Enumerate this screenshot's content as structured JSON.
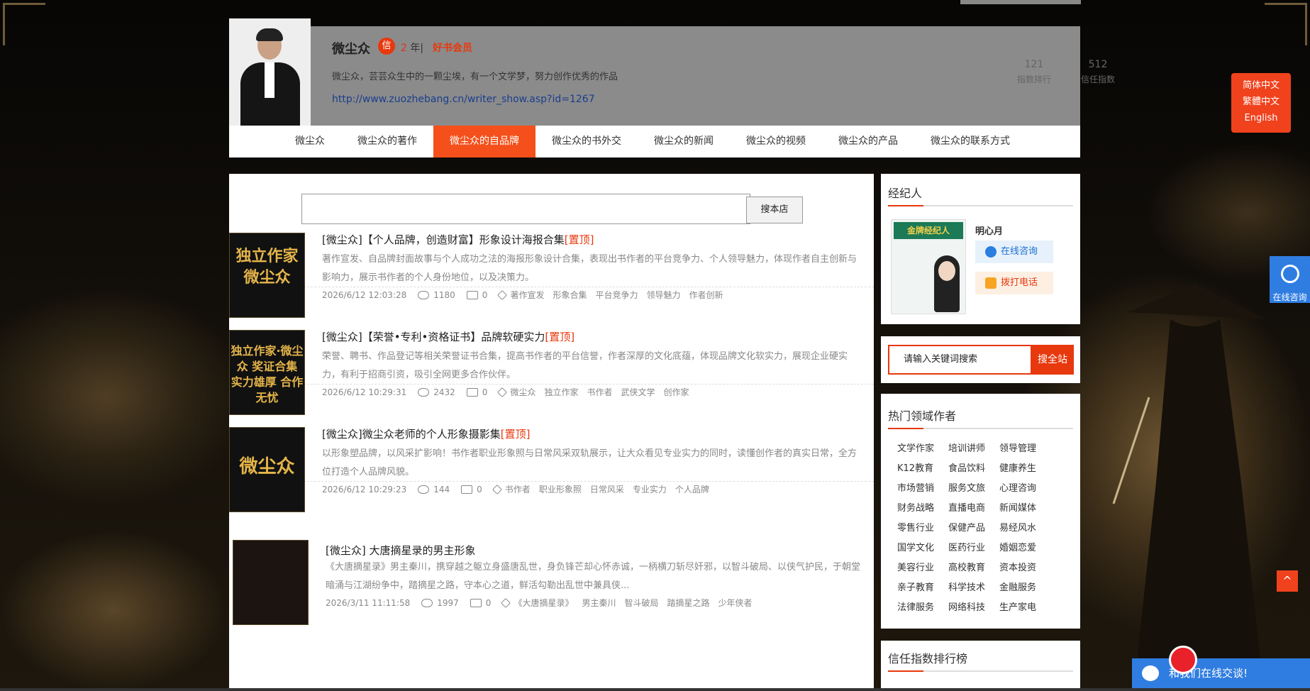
{
  "profile": {
    "name": "微尘众",
    "badge": "信",
    "years": "2",
    "years_unit": "年",
    "sep": "|",
    "member": "好书会员",
    "desc": "微尘众，芸芸众生中的一颗尘埃，有一个文学梦，努力创作优秀的作品",
    "url": "http://www.zuozhebang.cn/writer_show.asp?id=1267",
    "stats": [
      {
        "value": "121",
        "label": "指数排行"
      },
      {
        "value": "512",
        "label": "信任指数"
      }
    ]
  },
  "nav": {
    "items": [
      {
        "label": "微尘众"
      },
      {
        "label": "微尘众的著作"
      },
      {
        "label": "微尘众的自品牌"
      },
      {
        "label": "微尘众的书外交"
      },
      {
        "label": "微尘众的新闻"
      },
      {
        "label": "微尘众的视频"
      },
      {
        "label": "微尘众的产品"
      },
      {
        "label": "微尘众的联系方式"
      }
    ],
    "active_index": 2
  },
  "search": {
    "value": "",
    "button": "搜本店"
  },
  "items": [
    {
      "thumb": "独立作家 微尘众",
      "title": "[微尘众]【个人品牌，创造财富】形象设计海报合集",
      "top": "[置顶]",
      "desc": "著作宣发、自品牌封面故事与个人成功之法的海报形象设计合集，表现出书作者的平台竞争力、个人领导魅力，体现作者自主创新与影响力，展示书作者的个人身份地位，以及决策力。",
      "date": "2026/6/12 12:03:28",
      "views": "1180",
      "comments": "0",
      "tags": [
        "著作宣发",
        "形象合集",
        "平台竞争力",
        "领导魅力",
        "作者创新"
      ]
    },
    {
      "thumb": "独立作家·微尘众 奖证合集 实力雄厚 合作无忧",
      "title": "[微尘众]【荣誉•专利•资格证书】品牌软硬实力",
      "top": "[置顶]",
      "desc": "荣誉、聘书、作品登记等相关荣誉证书合集，提高书作者的平台信誉，作者深厚的文化底蕴，体现品牌文化软实力，展现企业硬实力，有利于招商引资，吸引全网更多合作伙伴。",
      "date": "2026/6/12 10:29:31",
      "views": "2432",
      "comments": "0",
      "tags": [
        "微尘众",
        "独立作家",
        "书作者",
        "武侠文学",
        "创作家"
      ]
    },
    {
      "thumb": "微尘众",
      "title": "[微尘众]微尘众老师的个人形象摄影集",
      "top": "[置顶]",
      "desc": "以形象塑品牌，以风采扩影响！书作者职业形象照与日常风采双轨展示，让大众看见专业实力的同时，读懂创作者的真实日常，全方位打造个人品牌风貌。",
      "date": "2026/6/12 10:29:23",
      "views": "144",
      "comments": "0",
      "tags": [
        "书作者",
        "职业形象照",
        "日常风采",
        "专业实力",
        "个人品牌"
      ]
    },
    {
      "thumb": "",
      "title": "[微尘众] 大唐摘星录的男主形象",
      "top": "",
      "desc": "《大唐摘星录》男主秦川，携穿越之躯立身盛唐乱世，身负锋芒却心怀赤诚，一柄横刀斩尽奸邪，以智斗破局、以侠气护民，于朝堂暗涌与江湖纷争中，踏摘星之路，守本心之道，鲜活勾勒出乱世中兼具侠...",
      "date": "2026/3/11 11:11:58",
      "views": "1997",
      "comments": "0",
      "tags": [
        "《大唐摘星录》",
        "男主秦川",
        "智斗破局",
        "踏摘星之路",
        "少年侠者"
      ]
    }
  ],
  "sidebar": {
    "agent": {
      "heading": "经纪人",
      "image_text": "金牌经纪人",
      "name": "明心月",
      "chat": "在线咨询",
      "call": "拨打电话"
    },
    "site_search": {
      "placeholder": "请输入关键词搜索",
      "button": "搜全站"
    },
    "hot": {
      "heading": "热门领域作者",
      "tags": [
        "文学作家",
        "培训讲师",
        "领导管理",
        "K12教育",
        "食品饮料",
        "健康养生",
        "市场营销",
        "服务文旅",
        "心理咨询",
        "财务战略",
        "直播电商",
        "新闻媒体",
        "零售行业",
        "保健产品",
        "易经风水",
        "国学文化",
        "医药行业",
        "婚姻恋爱",
        "美容行业",
        "高校教育",
        "资本投资",
        "亲子教育",
        "科学技术",
        "金融服务",
        "法律服务",
        "网络科技",
        "生产家电"
      ]
    },
    "rank": {
      "heading": "信任指数排行榜"
    }
  },
  "floating": {
    "lang": [
      "简体中文",
      "繁體中文",
      "English"
    ],
    "online": "在线咨询",
    "totop": "^",
    "chatbar": "和我们在线交谈!"
  },
  "colors": {
    "accent": "#e8380d",
    "nav_active": "#f5501b",
    "link": "#1a3e8c",
    "chat_blue": "#2f7de1"
  }
}
